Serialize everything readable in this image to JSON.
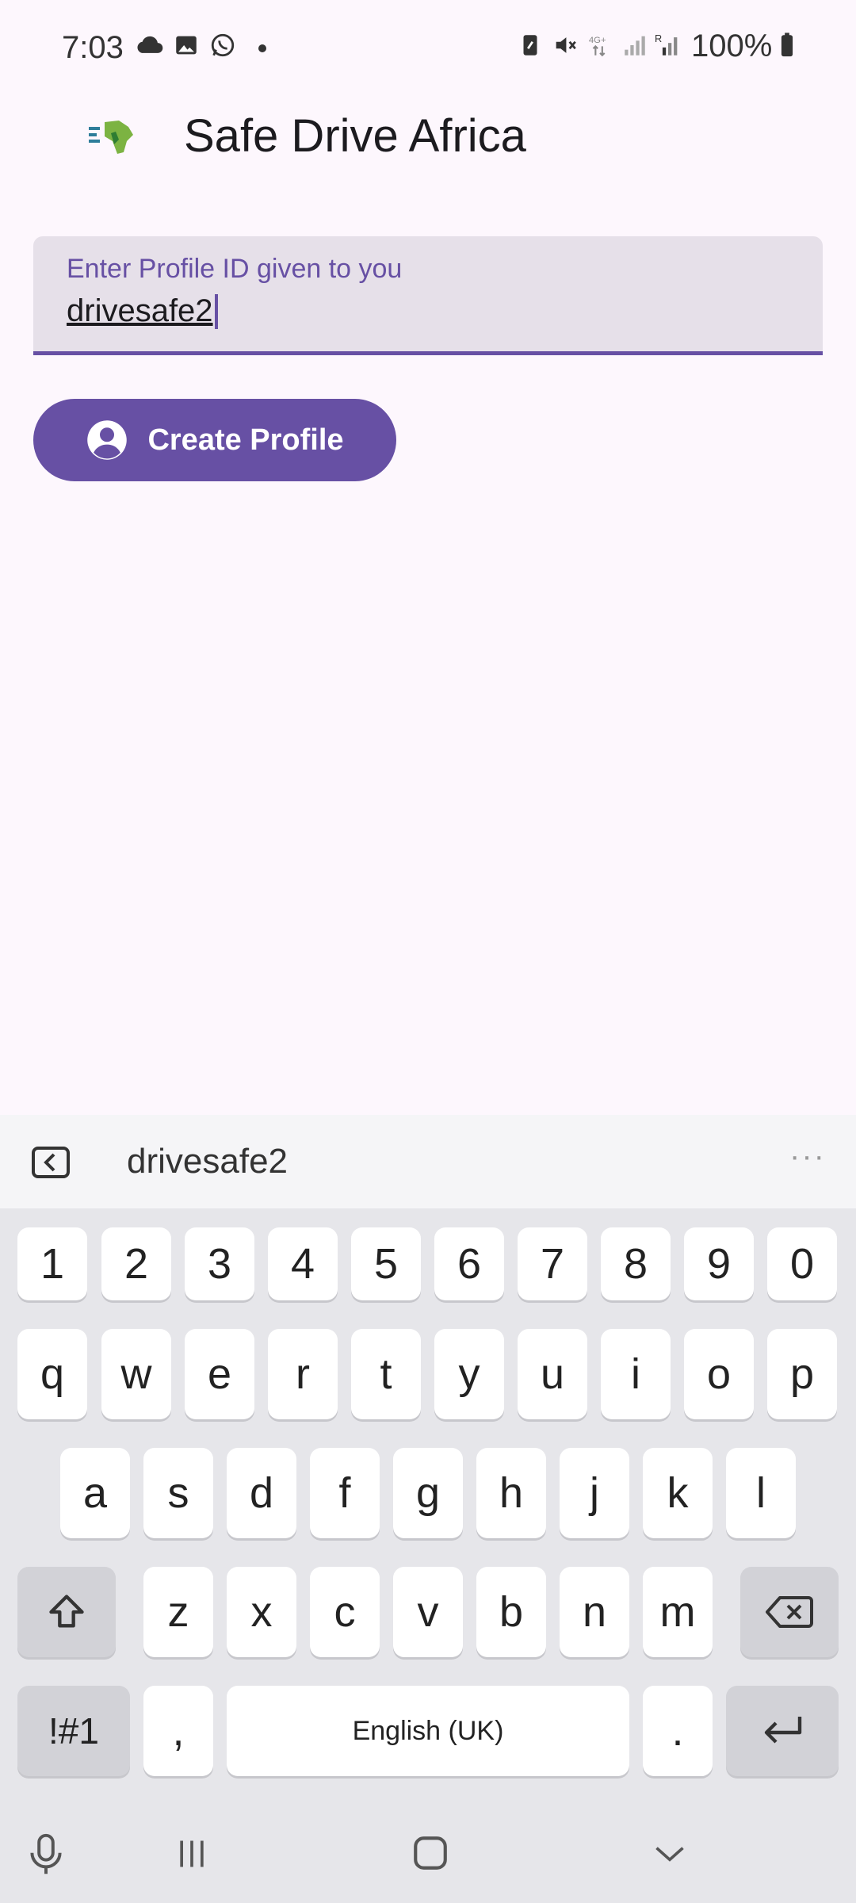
{
  "status_bar": {
    "time": "7:03",
    "battery": "100%"
  },
  "app_bar": {
    "title": "Safe Drive Africa",
    "logo_icon": "africa-map-logo-icon"
  },
  "profile_field": {
    "label": "Enter Profile ID given to you",
    "value": "drivesafe2"
  },
  "create_button": {
    "label": "Create Profile",
    "icon": "account-circle-icon"
  },
  "keyboard": {
    "suggestion": "drivesafe2",
    "row_numbers": [
      "1",
      "2",
      "3",
      "4",
      "5",
      "6",
      "7",
      "8",
      "9",
      "0"
    ],
    "row1": [
      "q",
      "w",
      "e",
      "r",
      "t",
      "y",
      "u",
      "i",
      "o",
      "p"
    ],
    "row2": [
      "a",
      "s",
      "d",
      "f",
      "g",
      "h",
      "j",
      "k",
      "l"
    ],
    "row3": [
      "z",
      "x",
      "c",
      "v",
      "b",
      "n",
      "m"
    ],
    "symbols_key": "!#1",
    "comma_key": ",",
    "space_label": "English (UK)",
    "period_key": "."
  },
  "colors": {
    "primary": "#6750a4",
    "background": "#fdf7fd",
    "field_bg": "#e6e0e9"
  }
}
